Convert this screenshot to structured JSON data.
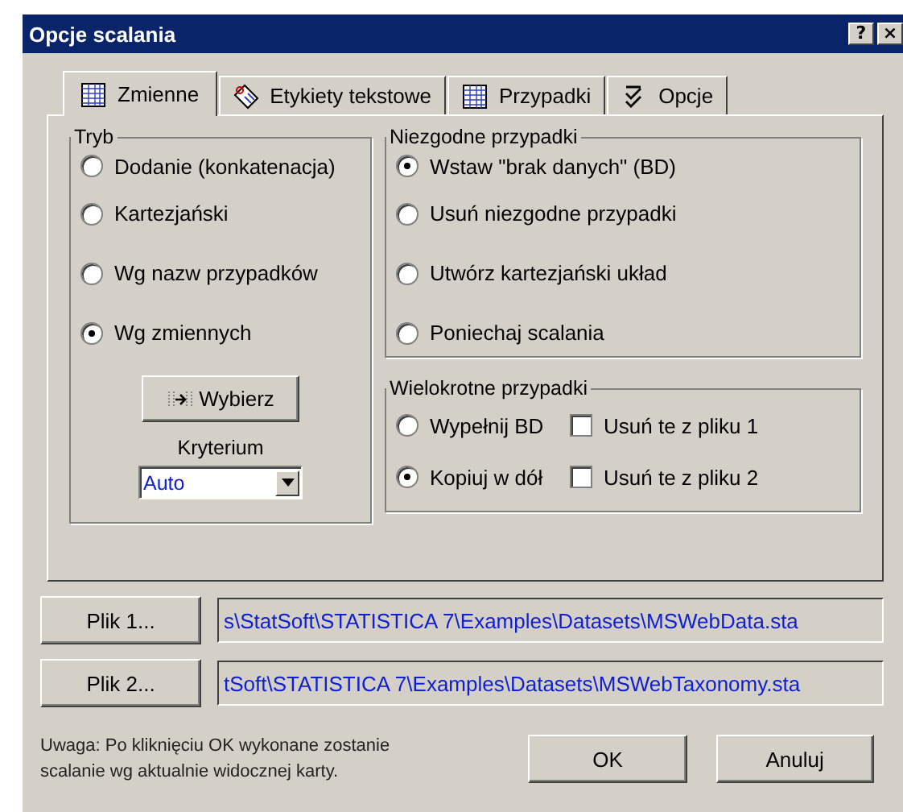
{
  "window": {
    "title": "Opcje scalania",
    "help_button": "?",
    "close_button": "×"
  },
  "tabs": [
    {
      "label": "Zmienne",
      "kind": "grid",
      "selected": true
    },
    {
      "label": "Etykiety tekstowe",
      "kind": "tag",
      "selected": false
    },
    {
      "label": "Przypadki",
      "kind": "grid",
      "selected": false
    },
    {
      "label": "Opcje",
      "kind": "checklist",
      "selected": false
    }
  ],
  "mode_group": {
    "title": "Tryb",
    "options": [
      {
        "label": "Dodanie (konkatenacja)",
        "selected": false
      },
      {
        "label": "Kartezjański",
        "selected": false
      },
      {
        "label": "Wg nazw przypadków",
        "selected": false
      },
      {
        "label": "Wg zmiennych",
        "selected": true
      }
    ],
    "select_button": "Wybierz",
    "criterion_label": "Kryterium",
    "criterion_value": "Auto"
  },
  "mismatch_group": {
    "title": "Niezgodne przypadki",
    "options": [
      {
        "label": "Wstaw \"brak danych\" (BD)",
        "selected": true
      },
      {
        "label": "Usuń niezgodne przypadki",
        "selected": false
      },
      {
        "label": "Utwórz kartezjański układ",
        "selected": false
      },
      {
        "label": "Poniechaj scalania",
        "selected": false
      }
    ]
  },
  "multiple_group": {
    "title": "Wielokrotne przypadki",
    "rows": [
      {
        "label": "Wypełnij BD",
        "selected": false,
        "checkbox": "Usuń te z pliku 1",
        "checked": false
      },
      {
        "label": "Kopiuj w dół",
        "selected": true,
        "checkbox": "Usuń te z pliku 2",
        "checked": false
      }
    ]
  },
  "files": [
    {
      "button": "Plik 1...",
      "path": "s\\StatSoft\\STATISTICA 7\\Examples\\Datasets\\MSWebData.sta"
    },
    {
      "button": "Plik 2...",
      "path": "tSoft\\STATISTICA 7\\Examples\\Datasets\\MSWebTaxonomy.sta"
    }
  ],
  "note": "Uwaga: Po kliknięciu OK wykonane zostanie scalanie wg aktualnie widocznej karty.",
  "buttons": [
    "OK",
    "Anuluj"
  ]
}
